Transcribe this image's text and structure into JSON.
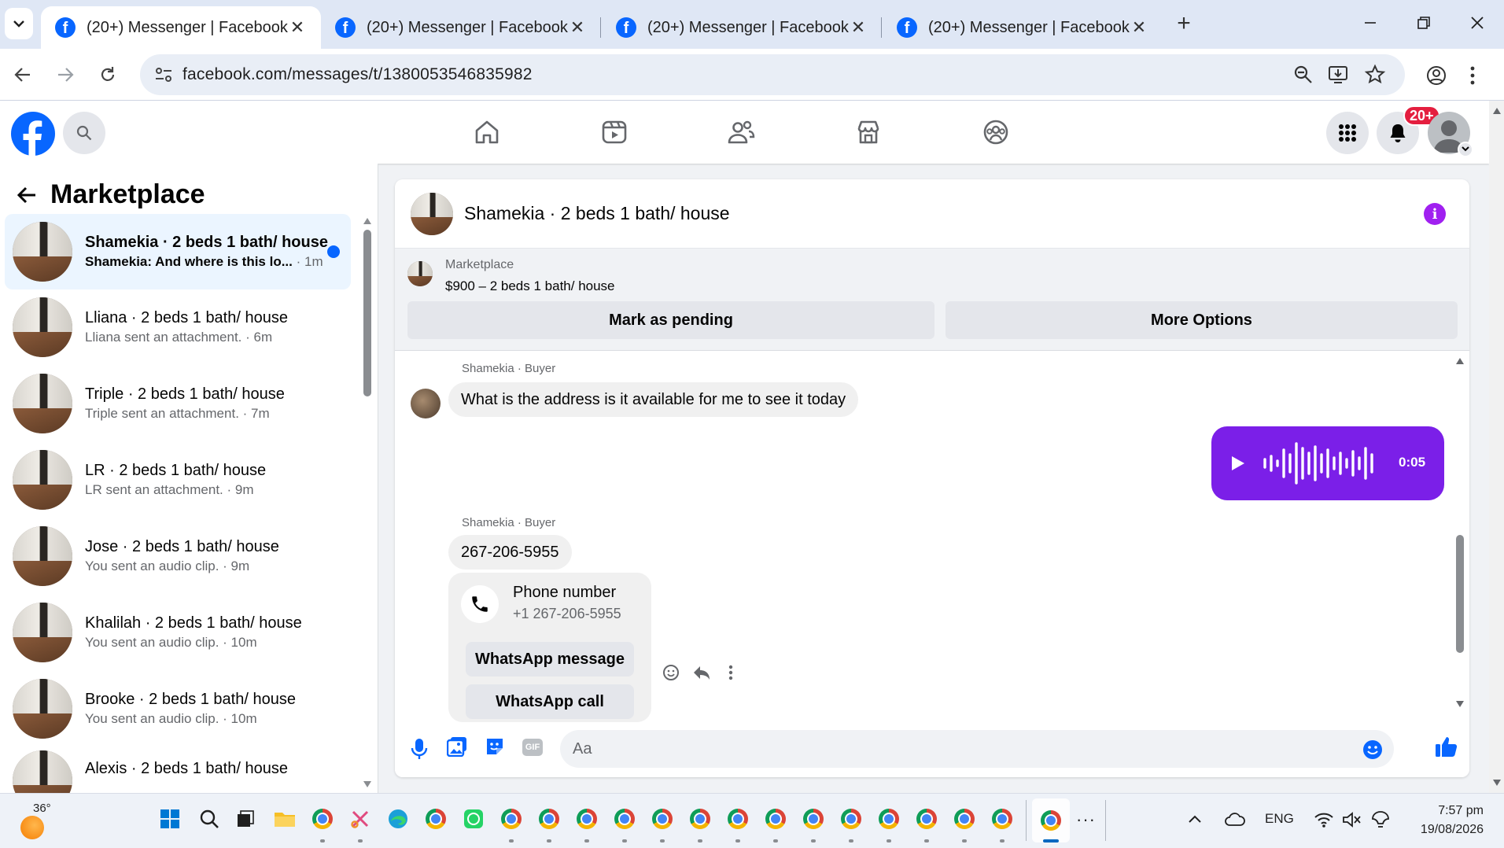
{
  "browser": {
    "tabs": [
      {
        "title": "(20+) Messenger | Facebook",
        "active": true
      },
      {
        "title": "(20+) Messenger | Facebook",
        "active": false
      },
      {
        "title": "(20+) Messenger | Facebook",
        "active": false
      },
      {
        "title": "(20+) Messenger | Facebook",
        "active": false
      }
    ],
    "new_tab": "+",
    "url": "facebook.com/messages/t/1380053546835982"
  },
  "fb": {
    "notification_badge": "20+",
    "nav_icons": [
      "home-icon",
      "video-icon",
      "friends-icon",
      "marketplace-icon",
      "groups-icon"
    ]
  },
  "sidebar": {
    "title": "Marketplace",
    "conversations": [
      {
        "name": "Shamekia · 2 beds 1 bath/ house",
        "preview": "Shamekia: And where is this lo...",
        "time": "· 1m",
        "unread": true
      },
      {
        "name": "Lliana · 2 beds 1 bath/ house",
        "preview": "Lliana sent an attachment. · 6m",
        "time": ""
      },
      {
        "name": "Triple · 2 beds 1 bath/ house",
        "preview": "Triple sent an attachment. · 7m",
        "time": ""
      },
      {
        "name": "LR · 2 beds 1 bath/ house",
        "preview": "LR sent an attachment. · 9m",
        "time": ""
      },
      {
        "name": "Jose · 2 beds 1 bath/ house",
        "preview": "You sent an audio clip. · 9m",
        "time": ""
      },
      {
        "name": "Khalilah · 2 beds 1 bath/ house",
        "preview": "You sent an audio clip. · 10m",
        "time": ""
      },
      {
        "name": "Brooke · 2 beds 1 bath/ house",
        "preview": "You sent an audio clip. · 10m",
        "time": ""
      },
      {
        "name": "Alexis · 2 beds 1 bath/ house",
        "preview": "",
        "time": ""
      }
    ]
  },
  "chat": {
    "title": "Shamekia · 2 beds 1 bath/ house",
    "marketplace_label": "Marketplace",
    "listing": "$900 – 2 beds 1 bath/ house",
    "mark_pending": "Mark as pending",
    "more_options": "More Options",
    "messages": [
      {
        "sender": "Shamekia · Buyer",
        "text": "What is the address is it available for me to see it today"
      },
      {
        "voice_duration": "0:05"
      },
      {
        "sender": "Shamekia · Buyer",
        "text": "267-206-5955"
      }
    ],
    "phone_card": {
      "title": "Phone number",
      "number": "+1 267-206-5955",
      "whatsapp_message": "WhatsApp message",
      "whatsapp_call": "WhatsApp call"
    },
    "composer_placeholder": "Aa"
  },
  "taskbar": {
    "weather": "36°",
    "language": "ENG",
    "time": "7:57 pm",
    "date": "19/08/2026"
  }
}
